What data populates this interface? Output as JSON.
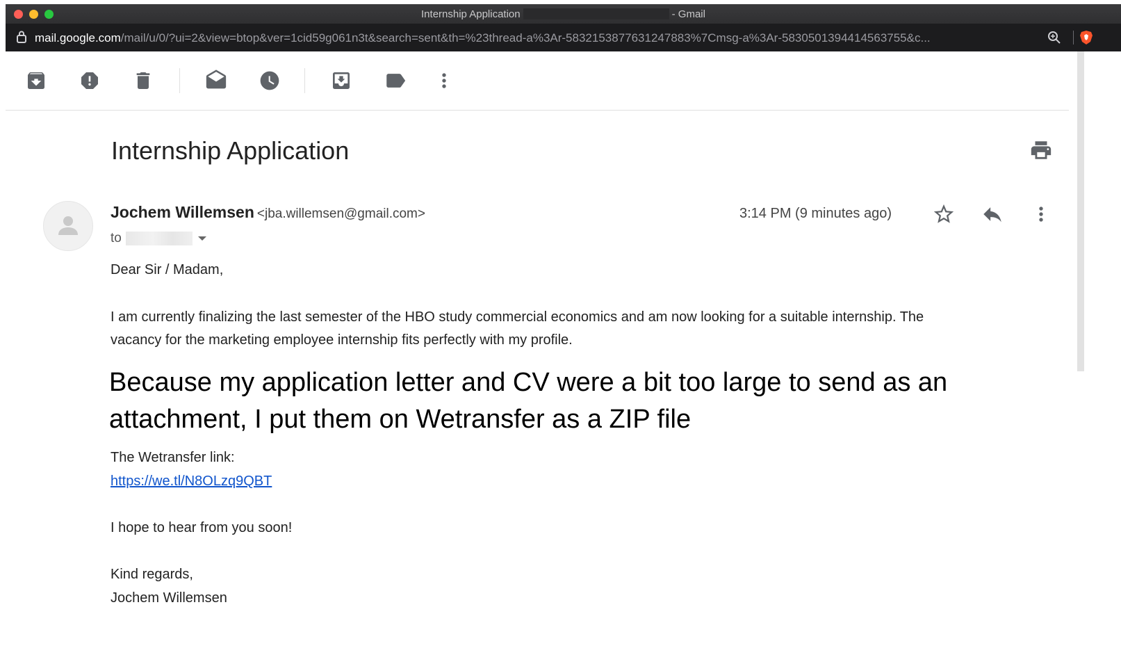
{
  "window": {
    "title_prefix": "Internship Application",
    "title_suffix": "- Gmail"
  },
  "urlbar": {
    "host": "mail.google.com",
    "path": "/mail/u/0/?ui=2&view=btop&ver=1cid59g061n3t&search=sent&th=%23thread-a%3Ar-5832153877631247883%7Cmsg-a%3Ar-5830501394414563755&c..."
  },
  "toolbar": {
    "icons": [
      "archive-icon",
      "report-spam-icon",
      "delete-icon",
      "mark-unread-icon",
      "snooze-icon",
      "move-to-icon",
      "label-icon",
      "more-vert-icon"
    ]
  },
  "email": {
    "subject": "Internship Application",
    "sender_name": "Jochem Willemsen",
    "sender_email": "<jba.willemsen@gmail.com>",
    "to_label": "to",
    "timestamp": "3:14 PM (9 minutes ago)",
    "body": {
      "greeting": "Dear Sir / Madam,",
      "para1_line1": "I am currently finalizing the last semester of the HBO study commercial economics and am now looking for a suitable internship. The",
      "para1_line2": "vacancy for the marketing employee internship fits perfectly with my profile.",
      "big_line1": "Because my application letter and CV were a bit too large to send as an",
      "big_line2": "attachment, I put them on Wetransfer as a ZIP file",
      "link_label": "The Wetransfer link:",
      "link_url": "https://we.tl/N8OLzq9QBT",
      "closing": "I hope to hear from you soon!",
      "signoff": "Kind regards,",
      "signature": "Jochem Willemsen"
    }
  },
  "colors": {
    "link": "#1155cc",
    "icon": "#5f6368",
    "titlebar": "#2f2f31",
    "urlbar": "#1c1c1e"
  }
}
